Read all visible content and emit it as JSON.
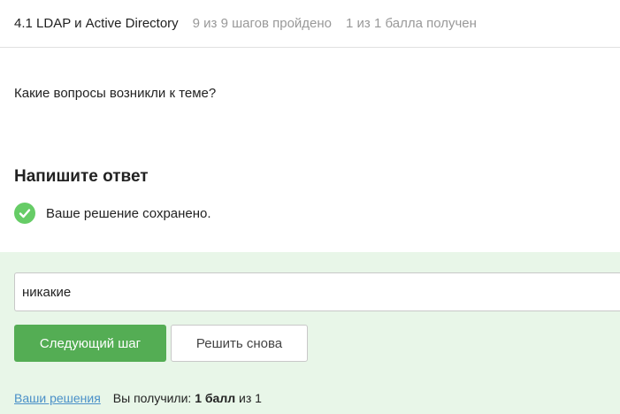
{
  "header": {
    "lesson_title": "4.1 LDAP и Active Directory",
    "progress": "9 из 9 шагов пройдено",
    "score": "1 из 1 балла  получен"
  },
  "step": {
    "question": "Какие вопросы возникли к теме?",
    "answer_heading": "Напишите ответ",
    "saved_message": "Ваше решение сохранено."
  },
  "answer": {
    "value": "никакие"
  },
  "buttons": {
    "next_label": "Следующий шаг",
    "retry_label": "Решить снова"
  },
  "footer": {
    "solutions_link": "Ваши решения",
    "earned_prefix": "Вы получили:",
    "earned_points": "1 балл",
    "earned_suffix": "из 1"
  },
  "colors": {
    "accent_green": "#54ad54",
    "check_green": "#66cc66",
    "feedback_background": "#e8f6e8",
    "link_blue": "#4a90c8"
  },
  "icons": {
    "saved": "check-circle-icon"
  }
}
